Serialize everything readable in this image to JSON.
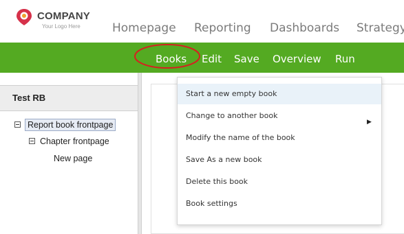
{
  "logo": {
    "name": "COMPANY",
    "tagline": "Your Logo Here",
    "accent": "#d6314a"
  },
  "top_nav": {
    "items": [
      "Homepage",
      "Reporting",
      "Dashboards",
      "Strategy"
    ]
  },
  "menu_bar": {
    "items": [
      "Books",
      "Edit",
      "Save",
      "Overview",
      "Run"
    ],
    "background": "#54aa22"
  },
  "left_panel": {
    "title": "Test RB",
    "tree": [
      {
        "label": "Report book frontpage",
        "selected": true
      },
      {
        "label": "Chapter frontpage"
      },
      {
        "label": "New page"
      }
    ]
  },
  "dropdown": {
    "items": [
      {
        "label": "Start a new empty book",
        "hovered": true
      },
      {
        "label": "Change to another book",
        "submenu_icon": "triangle-right-icon"
      },
      {
        "label": "Modify the name of the book"
      },
      {
        "label": "Save As a new book"
      },
      {
        "label": "Delete this book"
      },
      {
        "label": "Book settings"
      }
    ]
  },
  "annotation": {
    "color": "#d62020"
  }
}
